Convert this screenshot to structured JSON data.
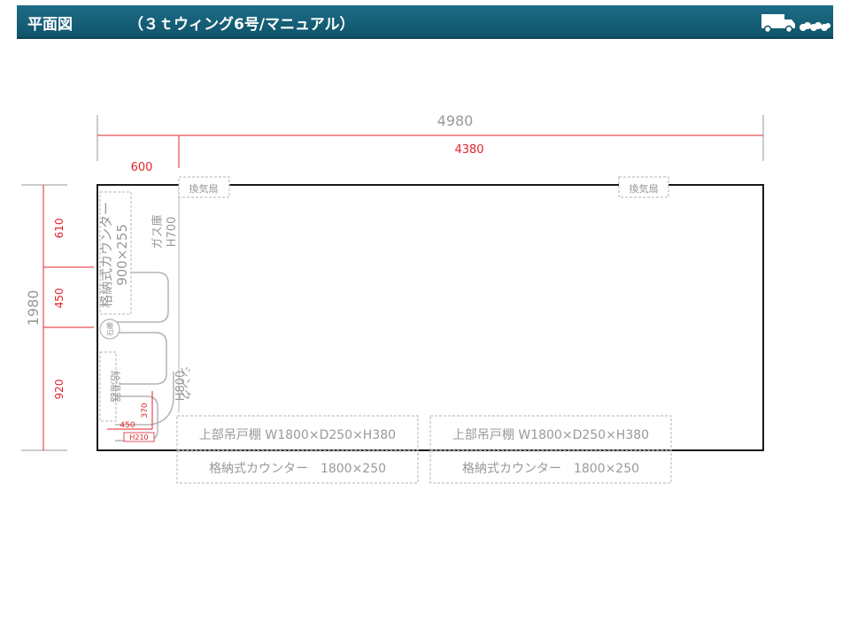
{
  "header": {
    "title": "平面図",
    "subtitle": "（３ｔウィング6号/マニュアル）",
    "truck_icon": "truck-icon"
  },
  "colors": {
    "header_bg": "#1a637b",
    "dimension_red": "#e0242b",
    "dimension_gray": "#999999",
    "outline": "#1a1a1a",
    "fixture_gray": "#b3b3b3"
  },
  "dimensions": {
    "total_length": "4980",
    "inner_length": "4380",
    "front_offset": "600",
    "total_width": "1980",
    "seg1": "610",
    "seg2": "450",
    "seg3": "920",
    "cabinet_w": "450",
    "cabinet_h": "370",
    "cabinet_depth": "H210"
  },
  "labels": {
    "vent_left": "換気扇",
    "vent_right": "換気扇",
    "gas_storage": "ガス庫",
    "gas_height": "H700",
    "counter_side_name": "格納式カウンター",
    "counter_side_size": "900×255",
    "sink": "シンク",
    "sink_height": "H800",
    "lever": "石鹸",
    "water_heater": "給湯器",
    "upper_shelf_1": "上部吊戸棚 W1800×D250×H380",
    "upper_shelf_2": "上部吊戸棚 W1800×D250×H380",
    "counter_bottom_1": "格納式カウンター　1800×250",
    "counter_bottom_2": "格納式カウンター　1800×250"
  }
}
